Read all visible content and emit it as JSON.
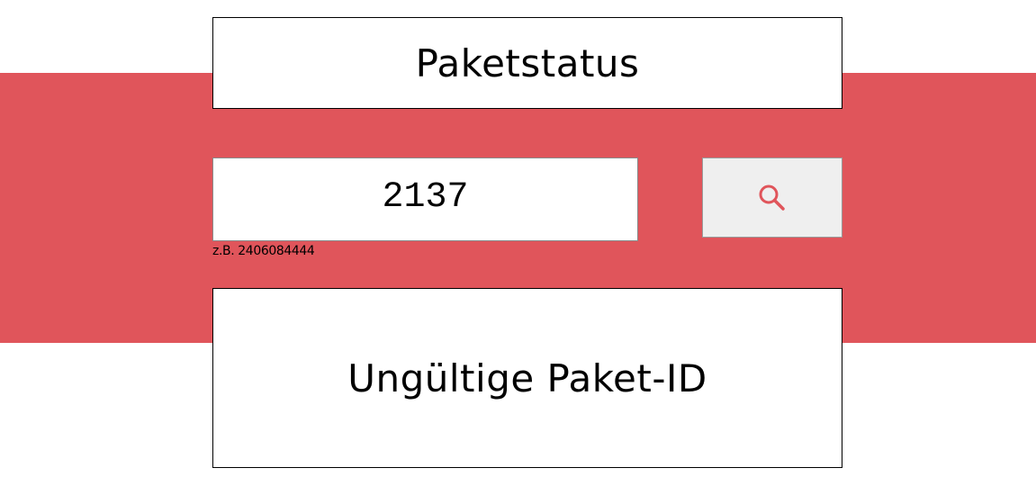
{
  "header": {
    "title": "Paketstatus"
  },
  "search": {
    "value": "2137",
    "hint": "z.B. 2406084444",
    "button_icon": "search-icon"
  },
  "result": {
    "message": "Ungültige Paket-ID"
  },
  "colors": {
    "accent": "#e0555b",
    "button_background": "#efefef",
    "icon": "#e0555b"
  }
}
